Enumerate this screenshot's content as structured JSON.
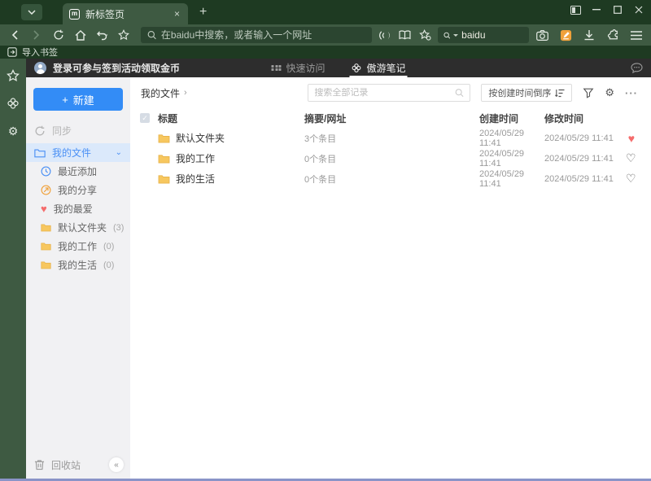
{
  "colors": {
    "accent_blue": "#338CF6",
    "folder_yellow": "#F7C75F",
    "heart_red": "#F56C6C",
    "notes_orange": "#F0A13A",
    "frame_green": "#1E3A22",
    "toolbar_green": "#3E5A42",
    "bottom_bar_blue": "#8A94C8"
  },
  "icons": {
    "heart_filled": "♥",
    "heart_outline": "♡",
    "collapse": "«",
    "gear": "⚙",
    "home": "⌂",
    "undo": "↶",
    "check": "✓",
    "breadcrumb_arrow": "›",
    "more": "···",
    "plus": "+",
    "close": "×",
    "chevron_down": "⌄"
  },
  "browser": {
    "tab_title": "新标签页",
    "address_placeholder": "在baidu中搜索，或者输入一个网址",
    "search_engine_value": "baidu",
    "import_bookmarks": "导入书签"
  },
  "page_header": {
    "login_text": "登录可参与签到活动领取金币",
    "tab_quick_access": "快速访问",
    "tab_notes": "傲游笔记"
  },
  "sidebar": {
    "new_button": "新建",
    "sync_label": "同步",
    "root_label": "我的文件",
    "items": [
      {
        "label": "最近添加",
        "count": ""
      },
      {
        "label": "我的分享",
        "count": ""
      },
      {
        "label": "我的最爱",
        "count": ""
      },
      {
        "label": "默认文件夹",
        "count": "(3)"
      },
      {
        "label": "我的工作",
        "count": "(0)"
      },
      {
        "label": "我的生活",
        "count": "(0)"
      }
    ],
    "recycle_bin": "回收站"
  },
  "content": {
    "breadcrumb": "我的文件",
    "search_placeholder": "搜索全部记录",
    "sort_label": "按创建时间倒序",
    "table": {
      "col_title": "标题",
      "col_summary": "摘要/网址",
      "col_created": "创建时间",
      "col_modified": "修改时间",
      "rows": [
        {
          "title": "默认文件夹",
          "summary": "3个条目",
          "created": "2024/05/29 11:41",
          "modified": "2024/05/29 11:41",
          "favorite": true
        },
        {
          "title": "我的工作",
          "summary": "0个条目",
          "created": "2024/05/29 11:41",
          "modified": "2024/05/29 11:41",
          "favorite": false
        },
        {
          "title": "我的生活",
          "summary": "0个条目",
          "created": "2024/05/29 11:41",
          "modified": "2024/05/29 11:41",
          "favorite": false
        }
      ]
    }
  }
}
